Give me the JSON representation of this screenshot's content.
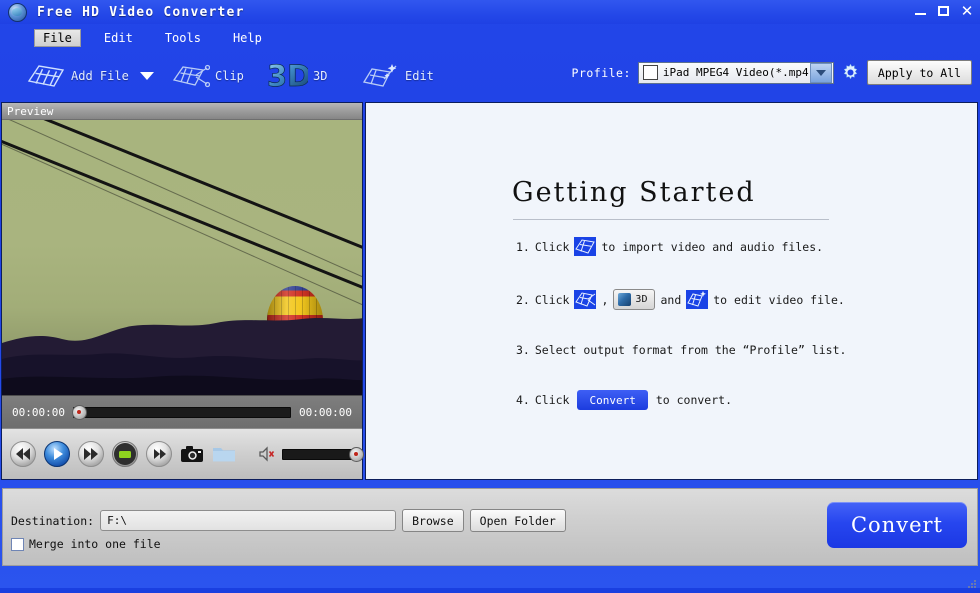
{
  "window": {
    "title": "Free HD Video Converter",
    "icon": "app-globe-icon",
    "minimize": "–",
    "maximize": "□",
    "close": "✕"
  },
  "menu": {
    "items": [
      {
        "label": "File",
        "active": true
      },
      {
        "label": "Edit",
        "active": false
      },
      {
        "label": "Tools",
        "active": false
      },
      {
        "label": "Help",
        "active": false
      }
    ]
  },
  "toolbar": {
    "add_file": "Add File",
    "clip": "Clip",
    "three_d": "3D",
    "edit": "Edit",
    "profile_label": "Profile:",
    "profile_value": "iPad MPEG4 Video(*.mp4)",
    "settings_icon": "gear-icon",
    "apply_to_all": "Apply to All"
  },
  "preview": {
    "header": "Preview",
    "current_time": "00:00:00",
    "total_time": "00:00:00",
    "controls": [
      "rewind-icon",
      "play-icon",
      "fast-forward-icon",
      "stop-icon",
      "next-frame-icon",
      "snapshot-icon",
      "folder-icon"
    ],
    "volume_icon": "speaker-muted-icon"
  },
  "getting_started": {
    "title": "Getting Started",
    "steps": [
      {
        "number": "1.",
        "pre": "Click",
        "post": "to import video and audio files."
      },
      {
        "number": "2.",
        "pre": "Click",
        "mid_comma": ",",
        "three_d_label": "3D",
        "and": "and",
        "post": "to edit video file."
      },
      {
        "number": "3.",
        "text": "Select output format from the “Profile” list."
      },
      {
        "number": "4.",
        "pre": "Click",
        "button_label": "Convert",
        "post": "to convert."
      }
    ]
  },
  "bottom": {
    "destination_label": "Destination:",
    "destination_value": "F:\\",
    "browse": "Browse",
    "open_folder": "Open Folder",
    "merge_label": "Merge into one file",
    "convert": "Convert"
  },
  "colors": {
    "window_blue": "#2346e8",
    "panel_bg": "#f1f5fb",
    "accent": "#1c3cde",
    "toolbar_text": "#e3ecff"
  }
}
